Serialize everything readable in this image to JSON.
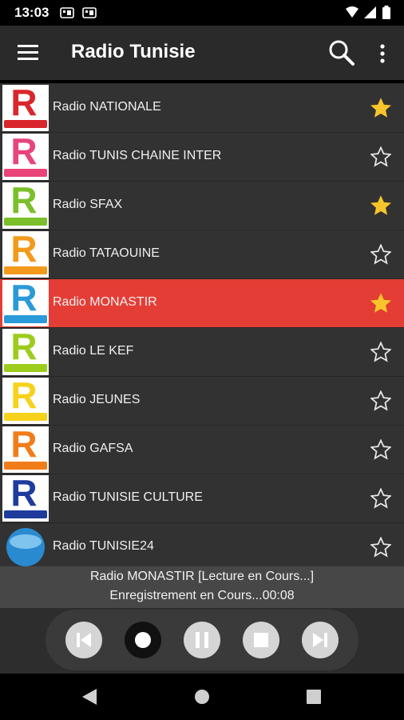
{
  "status_bar": {
    "time": "13:03",
    "icons": [
      "cast-icon",
      "cast-icon",
      "wifi-icon",
      "signal-icon",
      "battery-icon"
    ]
  },
  "app_bar": {
    "title": "Radio Tunisie",
    "icons": [
      "menu-icon",
      "search-icon",
      "more-vert-icon"
    ]
  },
  "stations": [
    {
      "name": "Radio NATIONALE",
      "favorite": true,
      "logo_color": "#d9262c"
    },
    {
      "name": "Radio TUNIS CHAINE INTER",
      "favorite": false,
      "logo_color": "#e8447a"
    },
    {
      "name": "Radio SFAX",
      "favorite": true,
      "logo_color": "#7bbf2a"
    },
    {
      "name": "Radio TATAOUINE",
      "favorite": false,
      "logo_color": "#f39a1c"
    },
    {
      "name": "Radio MONASTIR",
      "favorite": true,
      "logo_color": "#2a9ad8",
      "active": true
    },
    {
      "name": "Radio LE KEF",
      "favorite": false,
      "logo_color": "#9ccc1c"
    },
    {
      "name": "Radio JEUNES",
      "favorite": false,
      "logo_color": "#f6d21c"
    },
    {
      "name": "Radio GAFSA",
      "favorite": false,
      "logo_color": "#f07d1a"
    },
    {
      "name": "Radio TUNISIE CULTURE",
      "favorite": false,
      "logo_color": "#1f3b9c"
    },
    {
      "name": "Radio TUNISIE24",
      "favorite": false,
      "logo_color": "#2a8ad0"
    }
  ],
  "now_playing": {
    "line1": "Radio MONASTIR  [Lecture en Cours...]",
    "line2": "Enregistrement en Cours...00:08"
  },
  "controls": [
    "previous-icon",
    "record-icon",
    "pause-icon",
    "stop-icon",
    "next-icon"
  ],
  "nav_bar": [
    "back-icon",
    "home-icon",
    "recents-icon"
  ],
  "colors": {
    "active_row": "#e43d35",
    "star_favorite": "#f7c52b",
    "list_background": "#323232"
  }
}
